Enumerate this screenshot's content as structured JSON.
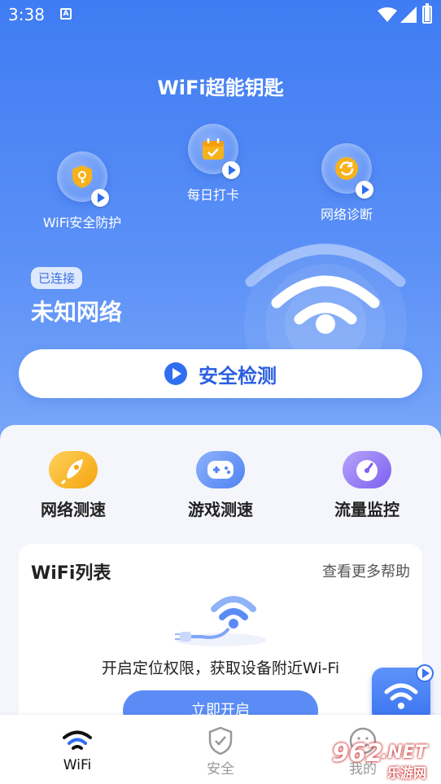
{
  "status_bar": {
    "time": "3:38",
    "notification": "A"
  },
  "app": {
    "title": "WiFi超能钥匙"
  },
  "features": [
    {
      "label": "WiFi安全防护",
      "icon": "shield-key-icon"
    },
    {
      "label": "每日打卡",
      "icon": "calendar-check-icon"
    },
    {
      "label": "网络诊断",
      "icon": "refresh-diagnose-icon"
    }
  ],
  "connection": {
    "badge": "已连接",
    "network_name": "未知网络"
  },
  "security_check": {
    "label": "安全检测"
  },
  "tools": [
    {
      "label": "网络测速",
      "icon": "rocket-icon",
      "color": "#f7b21b"
    },
    {
      "label": "游戏测速",
      "icon": "gamepad-icon",
      "color": "#5b8cf6"
    },
    {
      "label": "流量监控",
      "icon": "gauge-icon",
      "color": "#8b6cf3"
    }
  ],
  "wifi_list": {
    "title": "WiFi列表",
    "help_link": "查看更多帮助",
    "hint": "开启定位权限，获取设备附近Wi-Fi",
    "enable_button": "立即开启"
  },
  "tab_bar": {
    "tabs": [
      {
        "label": "WiFi",
        "active": true
      },
      {
        "label": "安全",
        "active": false
      },
      {
        "label": "我的",
        "active": false
      }
    ]
  },
  "watermark": {
    "text_a": "962",
    "text_b": ".NET",
    "text_c": "乐游网"
  },
  "colors": {
    "accent": "#2f6ef0",
    "hero_top": "#3f7cf3",
    "hero_bottom": "#7aa8f9"
  }
}
